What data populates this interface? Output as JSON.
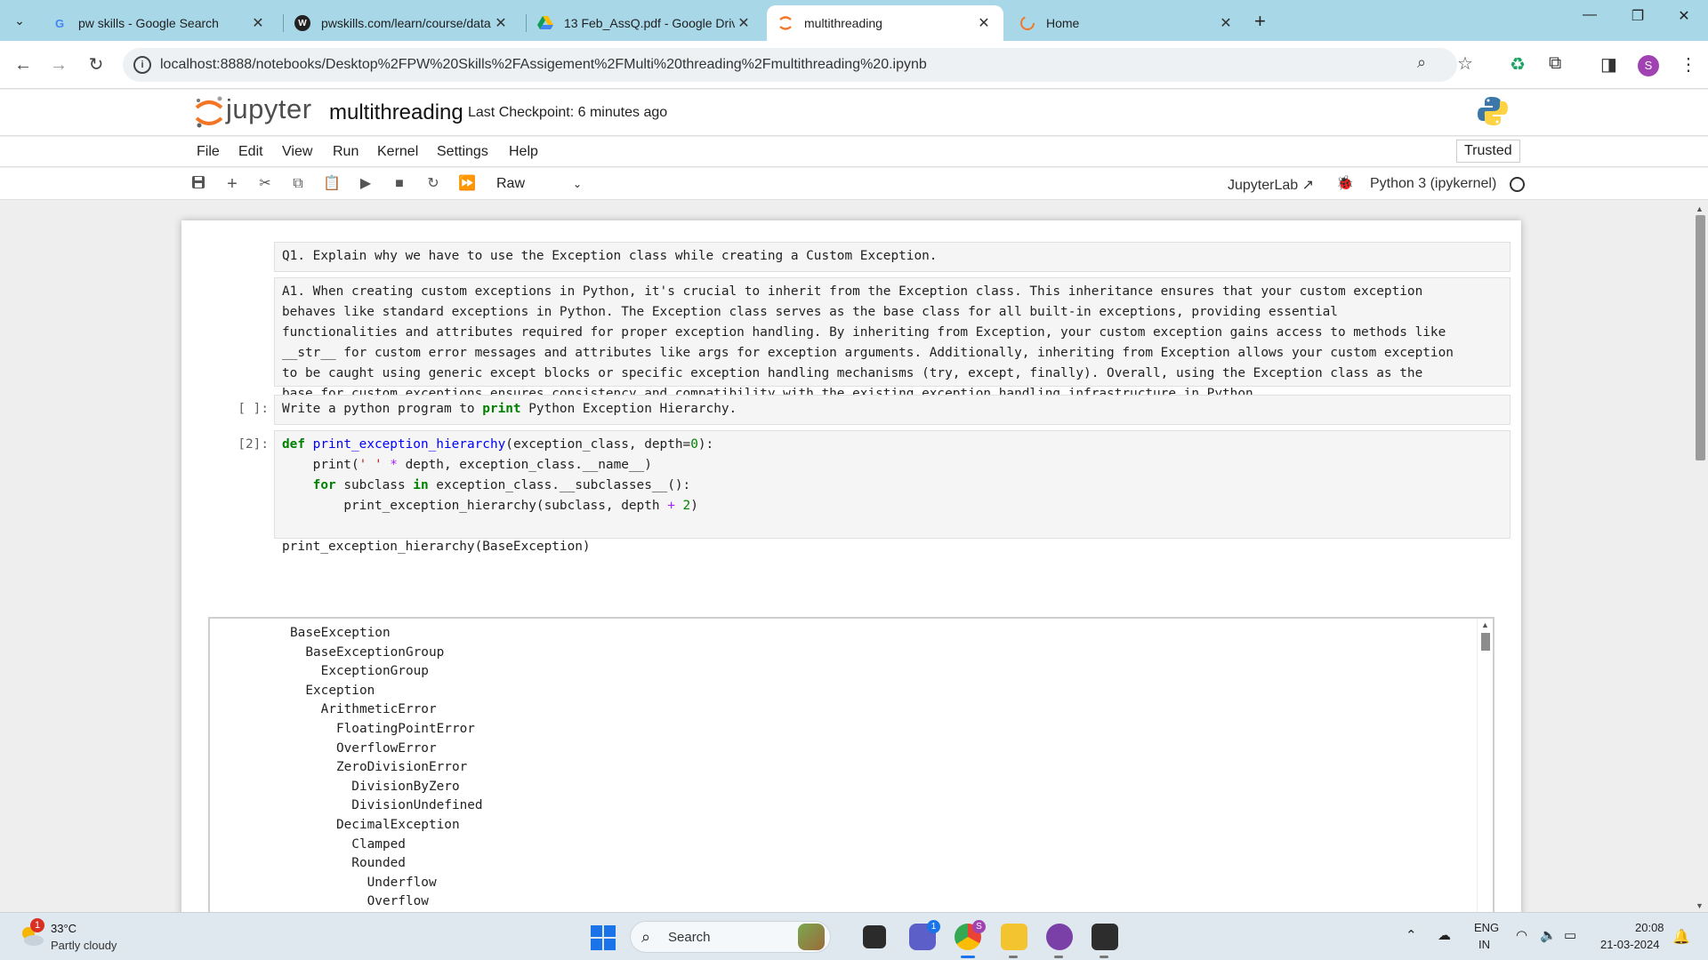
{
  "browser": {
    "tabs": [
      {
        "title": "pw skills - Google Search",
        "icon": "google-icon",
        "active": false
      },
      {
        "title": "pwskills.com/learn/course/data",
        "icon": "pwskills-icon",
        "active": false
      },
      {
        "title": "13 Feb_AssQ.pdf - Google Drive",
        "icon": "google-drive-icon",
        "active": false
      },
      {
        "title": "multithreading",
        "icon": "jupyter-icon",
        "active": true
      },
      {
        "title": "Home",
        "icon": "jupyter-icon",
        "active": false
      }
    ],
    "new_tab": "+",
    "url": "localhost:8888/notebooks/Desktop%2FPW%20Skills%2FAssigement%2FMulti%20threading%2Fmultithreading%20.ipynb",
    "profile_initial": "S"
  },
  "jupyter": {
    "logo_text": "jupyter",
    "notebook_title": "multithreading",
    "checkpoint": "Last Checkpoint: 6 minutes ago",
    "menu": [
      "File",
      "Edit",
      "View",
      "Run",
      "Kernel",
      "Settings",
      "Help"
    ],
    "trusted": "Trusted",
    "cell_type": "Raw",
    "jupyterlab_link": "JupyterLab",
    "kernel": "Python 3 (ipykernel)"
  },
  "cells": {
    "q1": "Q1. Explain why we have to use the Exception class while creating a Custom Exception.",
    "a1": "A1. When creating custom exceptions in Python, it's crucial to inherit from the Exception class. This inheritance ensures that your custom exception\nbehaves like standard exceptions in Python. The Exception class serves as the base class for all built-in exceptions, providing essential\nfunctionalities and attributes required for proper exception handling. By inheriting from Exception, your custom exception gains access to methods like\n__str__ for custom error messages and attributes like args for exception arguments. Additionally, inheriting from Exception allows your custom exception\nto be caught using generic except blocks or specific exception handling mechanisms (try, except, finally). Overall, using the Exception class as the\nbase for custom exceptions ensures consistency and compatibility with the existing exception handling infrastructure in Python.",
    "q2_prompt": "[ ]:",
    "q2": {
      "pre": "Write a python program to ",
      "kw": "print",
      "post": " Python Exception Hierarchy."
    },
    "code_prompt": "[2]:",
    "code": {
      "l1_kw": "def",
      "l1_fn": "print_exception_hierarchy",
      "l1_args": "(exception_class, depth=",
      "l1_num": "0",
      "l1_end": "):",
      "l2_a": "    print(",
      "l2_str": "' '",
      "l2_op": " * ",
      "l2_b": "depth, exception_class.__name__)",
      "l3_kw1": "    for",
      "l3_a": " subclass ",
      "l3_kw2": "in",
      "l3_b": " exception_class.__subclasses__():",
      "l4_a": "        print_exception_hierarchy(subclass, depth ",
      "l4_op": "+",
      "l4_num": " 2",
      "l4_end": ")",
      "l6": "print_exception_hierarchy(BaseException)"
    },
    "output": "BaseException\n  BaseExceptionGroup\n    ExceptionGroup\n  Exception\n    ArithmeticError\n      FloatingPointError\n      OverflowError\n      ZeroDivisionError\n        DivisionByZero\n        DivisionUndefined\n      DecimalException\n        Clamped\n        Rounded\n          Underflow\n          Overflow\n        Inexact"
  },
  "taskbar": {
    "weather_badge": "1",
    "temperature": "33°C",
    "condition": "Partly cloudy",
    "search_label": "Search",
    "teams_badge": "1",
    "chrome_badge": "S",
    "lang_line1": "ENG",
    "lang_line2": "IN",
    "time": "20:08",
    "date": "21-03-2024"
  }
}
